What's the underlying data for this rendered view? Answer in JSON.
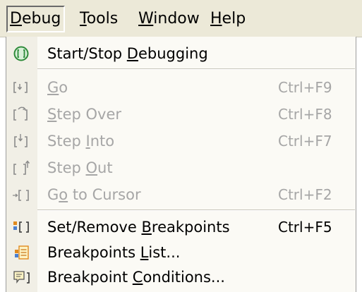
{
  "menubar": {
    "items": [
      {
        "pre": "",
        "mnemonic": "D",
        "post": "ebug"
      },
      {
        "pre": "",
        "mnemonic": "T",
        "post": "ools"
      },
      {
        "pre": "",
        "mnemonic": "W",
        "post": "indow"
      },
      {
        "pre": "",
        "mnemonic": "H",
        "post": "elp"
      }
    ]
  },
  "menu": {
    "items": [
      {
        "pre": "Start/Stop ",
        "mnemonic": "D",
        "post": "ebugging",
        "shortcut": "",
        "enabled": true,
        "icon": "start-stop-icon"
      },
      {
        "pre": "",
        "mnemonic": "G",
        "post": "o",
        "shortcut": "Ctrl+F9",
        "enabled": false,
        "icon": "go-icon"
      },
      {
        "pre": "",
        "mnemonic": "S",
        "post": "tep Over",
        "shortcut": "Ctrl+F8",
        "enabled": false,
        "icon": "step-over-icon"
      },
      {
        "pre": "Step ",
        "mnemonic": "I",
        "post": "nto",
        "shortcut": "Ctrl+F7",
        "enabled": false,
        "icon": "step-into-icon"
      },
      {
        "pre": "Step ",
        "mnemonic": "O",
        "post": "ut",
        "shortcut": "",
        "enabled": false,
        "icon": "step-out-icon"
      },
      {
        "pre": "G",
        "mnemonic": "o",
        "post": " to Cursor",
        "shortcut": "Ctrl+F2",
        "enabled": false,
        "icon": "go-to-cursor-icon"
      },
      {
        "pre": "Set/Remove ",
        "mnemonic": "B",
        "post": "reakpoints",
        "shortcut": "Ctrl+F5",
        "enabled": true,
        "icon": "breakpoint-toggle-icon"
      },
      {
        "pre": "Breakpoints ",
        "mnemonic": "L",
        "post": "ist...",
        "shortcut": "",
        "enabled": true,
        "icon": "breakpoints-list-icon"
      },
      {
        "pre": "Breakpoint ",
        "mnemonic": "C",
        "post": "onditions...",
        "shortcut": "",
        "enabled": true,
        "icon": "breakpoint-conditions-icon"
      }
    ]
  },
  "colors": {
    "menubar_bg": "#ece9d8",
    "disabled_text": "#a6a6a6",
    "icon_green": "#2e8b3a",
    "icon_orange": "#e08a1e",
    "icon_gray": "#8a8a8a"
  }
}
